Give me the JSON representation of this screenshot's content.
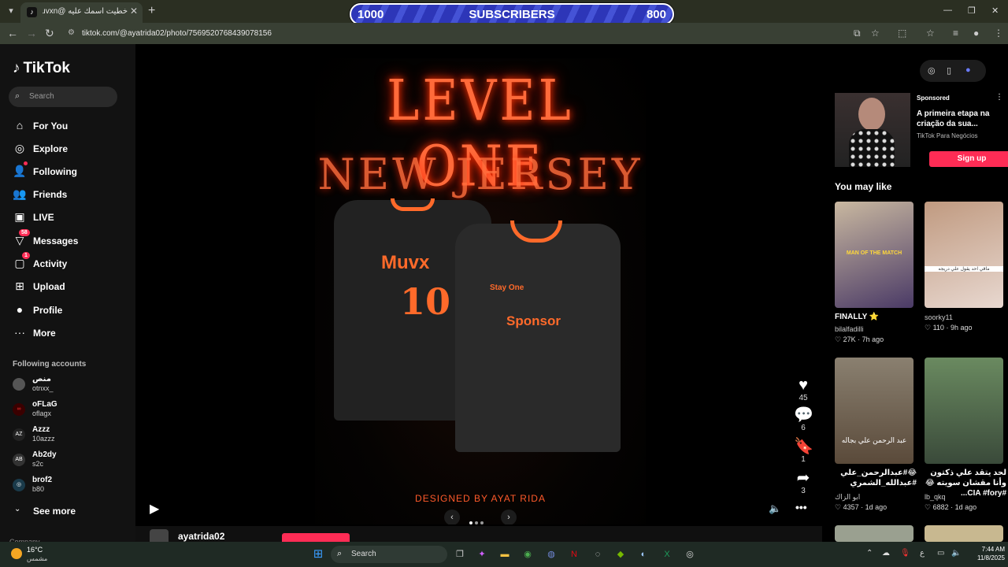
{
  "browser": {
    "tab_title": "خطيت اسمك عليه @Muvxn #اغ",
    "url": "tiktok.com/@ayatrida02/photo/7569520768439078156"
  },
  "overlay": {
    "left": "1000",
    "label": "SUBSCRIBERS",
    "right": "800"
  },
  "sidebar": {
    "logo": "TikTok",
    "search_placeholder": "Search",
    "nav": [
      {
        "label": "For You",
        "icon": "home-icon"
      },
      {
        "label": "Explore",
        "icon": "compass-icon"
      },
      {
        "label": "Following",
        "icon": "following-icon"
      },
      {
        "label": "Friends",
        "icon": "friends-icon"
      },
      {
        "label": "LIVE",
        "icon": "live-icon"
      },
      {
        "label": "Messages",
        "icon": "messages-icon",
        "badge": "58"
      },
      {
        "label": "Activity",
        "icon": "activity-icon",
        "badge": "1"
      },
      {
        "label": "Upload",
        "icon": "upload-icon"
      },
      {
        "label": "Profile",
        "icon": "profile-icon"
      },
      {
        "label": "More",
        "icon": "more-icon"
      }
    ],
    "following_title": "Following accounts",
    "following": [
      {
        "name": "منص",
        "handle": "otnxx_"
      },
      {
        "name": "oFLaG",
        "handle": "oflagx"
      },
      {
        "name": "Azzz",
        "handle": "10azzz"
      },
      {
        "name": "Ab2dy",
        "handle": "s2c"
      },
      {
        "name": "brof2",
        "handle": "b80"
      }
    ],
    "see_more": "See more",
    "company": "Company"
  },
  "post": {
    "title": "LEVEL ONE",
    "subtitle": "NEW JERSEY",
    "jersey_name": "Muvx",
    "jersey_number": "10",
    "stay_one": "Stay One",
    "sponsor": "Sponsor",
    "designed_by": "DESIGNED BY AYAT RIDA",
    "author": "ayatrida02",
    "likes": "45",
    "comments": "6",
    "saves": "1",
    "shares": "3"
  },
  "right": {
    "ad": {
      "sponsored": "Sponsored",
      "headline": "A primeira etapa na criação da sua...",
      "brand": "TikTok Para Negócios",
      "cta": "Sign up"
    },
    "you_may_like": "You may like",
    "recs": [
      {
        "caption": "FINALLY ⭐",
        "user": "bilalfadilli",
        "likes": "27K",
        "age": "7h ago",
        "thumb_text": "MAN OF THE MATCH"
      },
      {
        "caption": "",
        "user": "soorky11",
        "likes": "110",
        "age": "9h ago",
        "thumb_text": "ماقي احد يقول علي دريجه"
      },
      {
        "caption": "😂#عبدالرحمن_علي #عبدالله_الشمري",
        "user": "ابو الزاك",
        "likes": "4357",
        "age": "1d ago",
        "thumb_text": "عبد الرحمن علي بجاله"
      },
      {
        "caption": "لحد يتقد علي ذكتون وأنا مقشان سويته 😂 #CIA #fory...",
        "user": "lb_qkq",
        "likes": "6882",
        "age": "1d ago",
        "thumb_text": ""
      }
    ]
  },
  "taskbar": {
    "temp": "16°C",
    "condition": "مشمس",
    "search": "Search",
    "time": "7:44 AM",
    "date": "11/8/2025",
    "lang": "ع"
  }
}
